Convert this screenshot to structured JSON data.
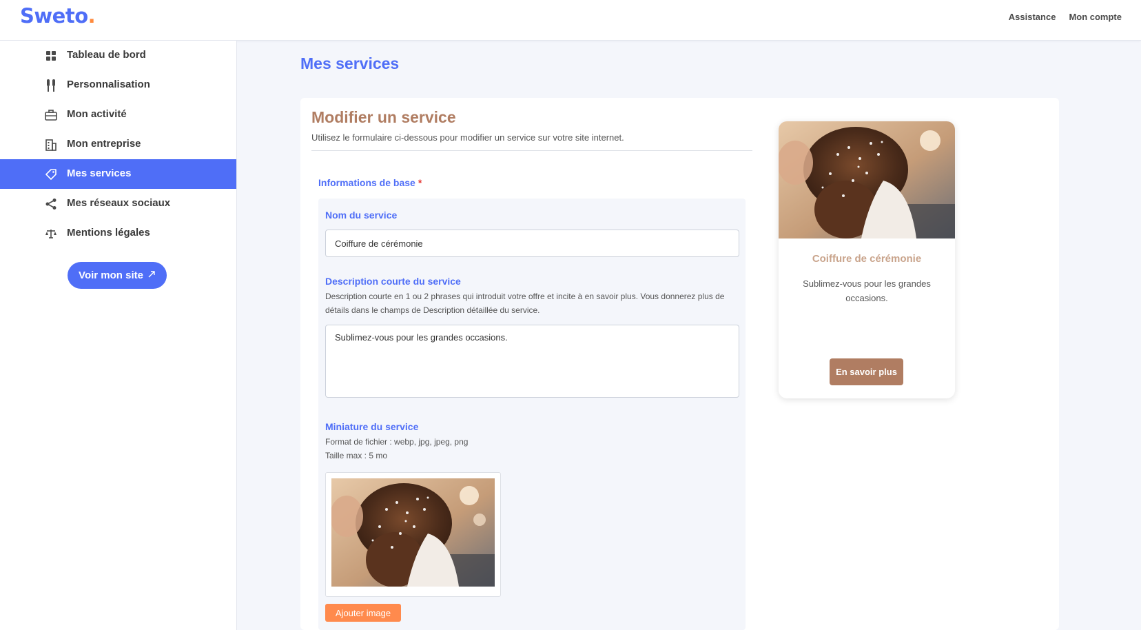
{
  "brand": {
    "name": "Sweto",
    "dot": ".",
    "colors": {
      "primary": "#4f6ef7",
      "accent": "#ff8a3d",
      "brown": "#b07d62"
    }
  },
  "topbar": {
    "links": [
      "Assistance",
      "Mon compte"
    ]
  },
  "sidebar": {
    "items": [
      {
        "label": "Tableau de bord",
        "icon": "dashboard-grid-icon",
        "active": false
      },
      {
        "label": "Personnalisation",
        "icon": "brushes-icon",
        "active": false
      },
      {
        "label": "Mon activité",
        "icon": "briefcase-icon",
        "active": false
      },
      {
        "label": "Mon entreprise",
        "icon": "building-icon",
        "active": false
      },
      {
        "label": "Mes services",
        "icon": "tag-icon",
        "active": true
      },
      {
        "label": "Mes réseaux sociaux",
        "icon": "share-icon",
        "active": false
      },
      {
        "label": "Mentions légales",
        "icon": "scales-icon",
        "active": false
      }
    ],
    "visit_button": "Voir mon site",
    "visit_icon": "external-arrow-icon"
  },
  "main": {
    "page_title": "Mes services",
    "card_title": "Modifier un service",
    "card_subtitle": "Utilisez le formulaire ci-dessous pour modifier un service sur votre site internet.",
    "section_label": "Informations de base",
    "required_mark": "*",
    "fields": {
      "name": {
        "label": "Nom du service",
        "value": "Coiffure de cérémonie"
      },
      "short_description": {
        "label": "Description courte du service",
        "help": "Description courte en 1 ou 2 phrases qui introduit votre offre et incite à en savoir plus. Vous donnerez plus de détails dans le champs de Description détaillée du service.",
        "value": "Sublimez-vous pour les grandes occasions."
      },
      "thumbnail": {
        "label": "Miniature du service",
        "formats": "Format de fichier : webp, jpg, jpeg, png",
        "max_size": "Taille max : 5 mo",
        "add_button": "Ajouter image"
      }
    },
    "preview": {
      "title": "Coiffure de cérémonie",
      "description": "Sublimez-vous pour les grandes occasions.",
      "button": "En savoir plus"
    }
  }
}
